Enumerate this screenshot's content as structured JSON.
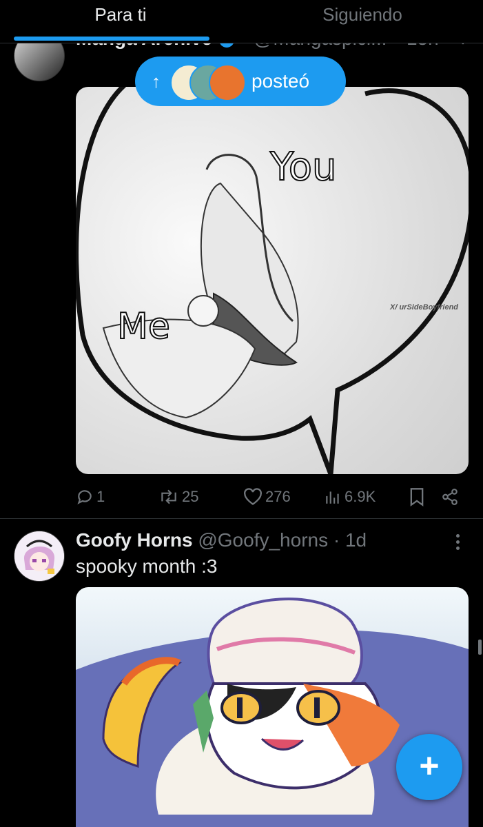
{
  "tabs": {
    "for_you": "Para ti",
    "following": "Siguiendo"
  },
  "colors": {
    "accent": "#1d9bf0",
    "muted": "#71767b",
    "text": "#e7e9ea",
    "background": "#000000"
  },
  "tweet1": {
    "author_name": "Manga Archive",
    "handle": "@Mangaspici...",
    "time": "15h",
    "reposted_pill": {
      "label": "posteó",
      "icon": "arrow-up-icon"
    },
    "media": {
      "text_top": "You",
      "text_bottom": "Me",
      "watermark": "X/ urSideBoyfriend"
    },
    "stats": {
      "replies": "1",
      "reposts": "25",
      "likes": "276",
      "views": "6.9K"
    }
  },
  "tweet2": {
    "author_name": "Goofy Horns",
    "handle": "@Goofy_horns",
    "separator": "·",
    "time": "1d",
    "text": "spooky month :3"
  },
  "fab": {
    "label": "+"
  }
}
